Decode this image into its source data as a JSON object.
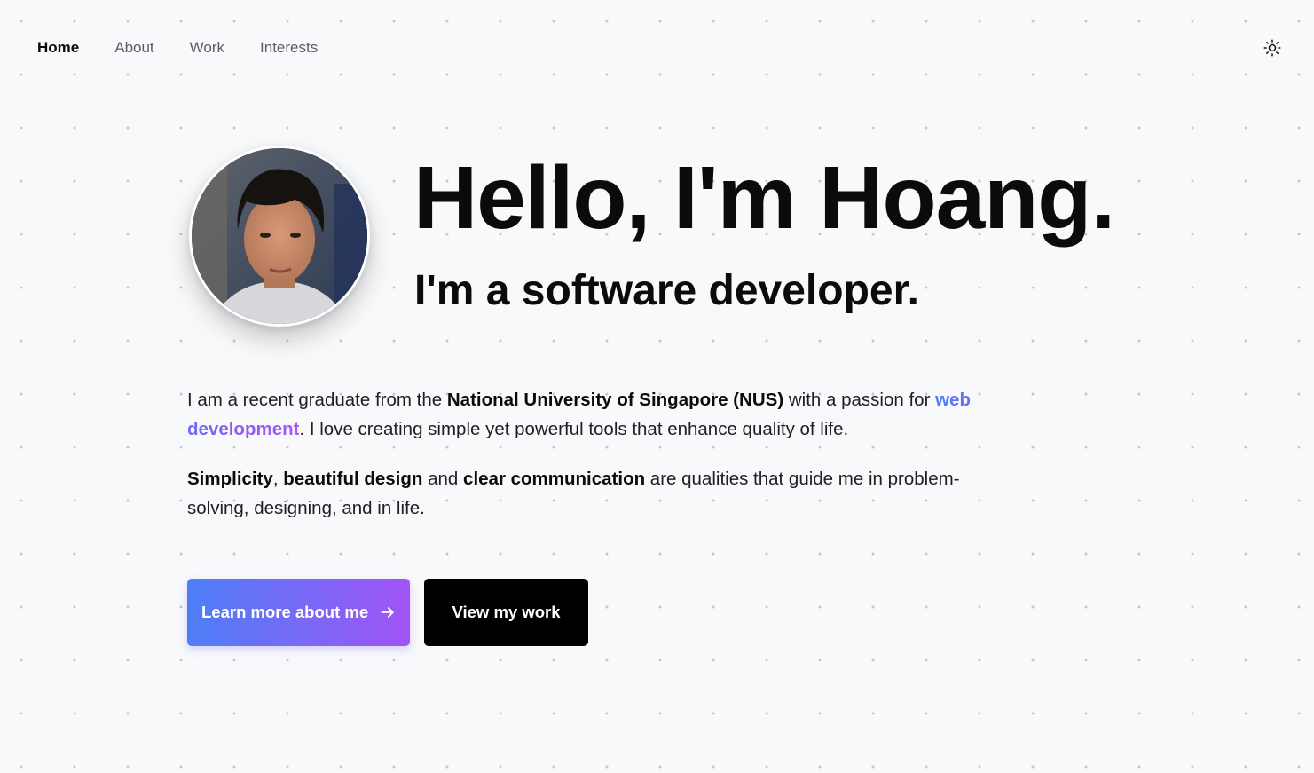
{
  "nav": {
    "links": [
      {
        "label": "Home",
        "active": true
      },
      {
        "label": "About",
        "active": false
      },
      {
        "label": "Work",
        "active": false
      },
      {
        "label": "Interests",
        "active": false
      }
    ],
    "theme_toggle_icon": "sun-icon"
  },
  "hero": {
    "title": "Hello, I'm Hoang.",
    "subtitle": "I'm a software developer."
  },
  "intro": {
    "part1": "I am a recent graduate from the ",
    "university": "National University of Singapore (NUS)",
    "part2": " with a passion for ",
    "highlight": "web development",
    "part3": ". I love creating simple yet powerful tools that enhance quality of life."
  },
  "values": {
    "v1": "Simplicity",
    "sep1": ", ",
    "v2": "beautiful design",
    "sep2": " and ",
    "v3": "clear communication",
    "rest": " are qualities that guide me in problem-solving, designing, and in life."
  },
  "buttons": {
    "primary_label": "Learn more about me",
    "primary_icon": "arrow-right-icon",
    "secondary_label": "View my work"
  },
  "colors": {
    "background": "#f8f9fb",
    "dot": "#c3c6cc",
    "accent_start": "#4d7ff7",
    "accent_end": "#a154f5",
    "text": "#0b0b0b"
  }
}
